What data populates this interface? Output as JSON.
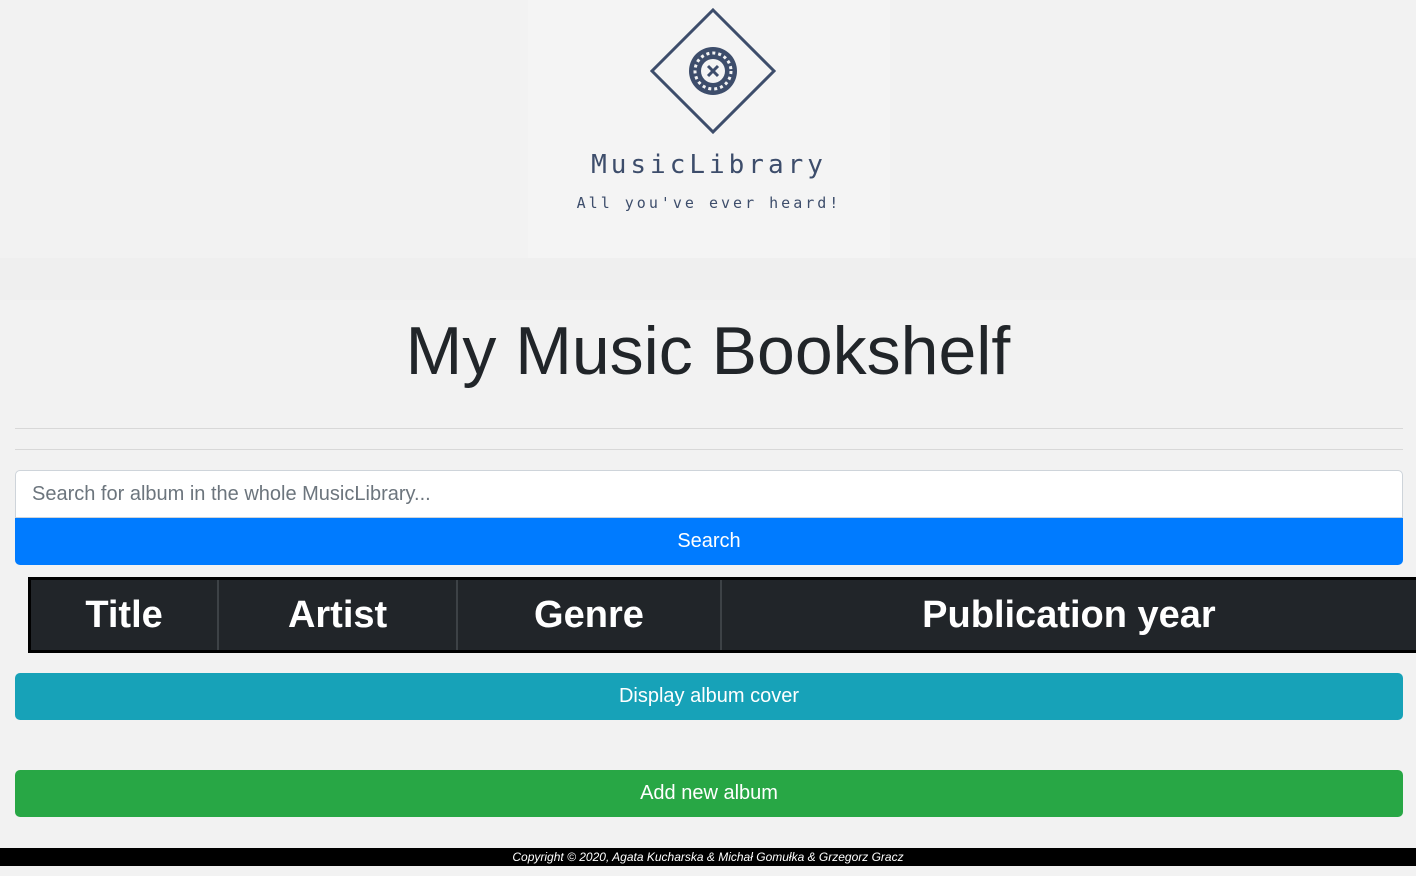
{
  "logo": {
    "icon": "vinyl-disc-icon",
    "name": "MusicLibrary",
    "tagline": "All you've ever heard!",
    "color": "#3d4d6b"
  },
  "page": {
    "title": "My Music Bookshelf"
  },
  "search": {
    "placeholder": "Search for album in the whole MusicLibrary...",
    "value": "",
    "button_label": "Search"
  },
  "table": {
    "columns": [
      "Title",
      "Artist",
      "Genre",
      "Publication year"
    ],
    "rows": []
  },
  "actions": {
    "display_cover_label": "Display album cover",
    "add_album_label": "Add new album"
  },
  "footer": {
    "text": "Copyright © 2020, Agata Kucharska & Michał Gomułka & Grzegorz Gracz"
  },
  "colors": {
    "primary": "#007bff",
    "info": "#17a2b8",
    "success": "#28a745",
    "table_header": "#212529"
  }
}
